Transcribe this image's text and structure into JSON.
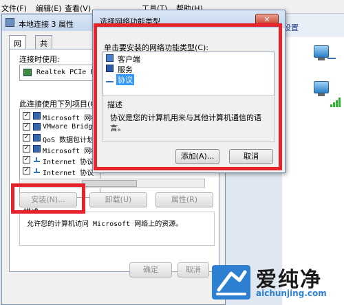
{
  "menubar": {
    "items": [
      "文件(F)",
      "编辑(E)",
      "查看(V)",
      "工具(T)",
      "帮助(H)"
    ]
  },
  "bg_window": {
    "toolbar_text": "设置"
  },
  "properties_dialog": {
    "title": "本地连接 3 属性",
    "tabs": [
      "网络",
      "共享"
    ],
    "connect_using_label": "连接时使用:",
    "adapter_name": "Realtek PCIe FE",
    "items_label": "此连接使用下列项目(O):",
    "components": [
      {
        "label": "Microsoft 网络",
        "checked": true,
        "icon": "client-icon"
      },
      {
        "label": "VMware Bridge",
        "checked": true,
        "icon": "service-icon"
      },
      {
        "label": "QoS 数据包计划",
        "checked": true,
        "icon": "service-icon"
      },
      {
        "label": "Microsoft 网络",
        "checked": true,
        "icon": "service-icon"
      },
      {
        "label": "Internet 协议",
        "checked": true,
        "icon": "protocol-icon"
      },
      {
        "label": "Internet 协议",
        "checked": true,
        "icon": "protocol-icon"
      }
    ],
    "install_button": "安装(N)...",
    "uninstall_button": "卸载(U)",
    "properties_button": "属性(R)",
    "description_label": "描述",
    "description_text": "允许您的计算机访问 Microsoft 网络上的资源。",
    "ok_button": "确定",
    "cancel_button": "取消"
  },
  "select_dialog": {
    "title": "选择网络功能类型",
    "close_glyph": "✕",
    "prompt": "单击要安装的网络功能类型(C):",
    "types": [
      {
        "label": "客户端",
        "selected": false
      },
      {
        "label": "服务",
        "selected": false
      },
      {
        "label": "协议",
        "selected": true
      }
    ],
    "description_label": "描述",
    "description_text": "协议是您的计算机用来与其他计算机通信的语言。",
    "add_button": "添加(A)...",
    "cancel_button": "取消"
  },
  "watermark": {
    "name": "爱纯净",
    "url": "aichunjing.com"
  },
  "colors": {
    "highlight_red": "#e6232b",
    "selection_blue": "#3399ff",
    "watermark_blue": "#2d7fd1"
  }
}
